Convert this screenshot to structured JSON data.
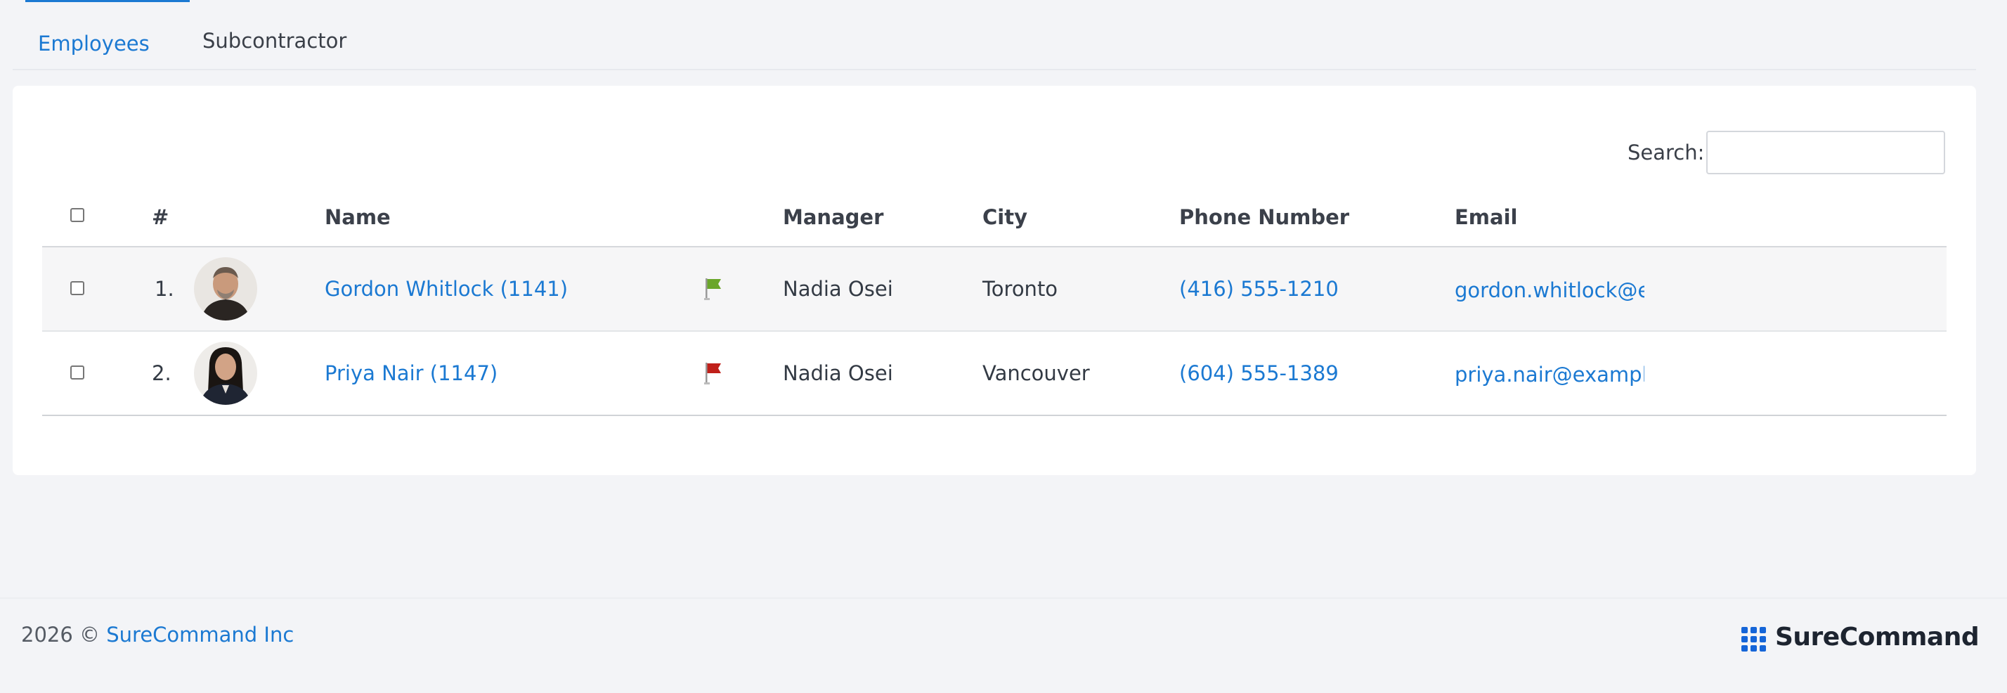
{
  "tabs": [
    {
      "label": "Employees",
      "active": true
    },
    {
      "label": "Subcontractor",
      "active": false
    }
  ],
  "search": {
    "label": "Search:",
    "value": ""
  },
  "table": {
    "headers": {
      "number": "#",
      "name": "Name",
      "manager": "Manager",
      "city": "City",
      "phone": "Phone Number",
      "email": "Email"
    },
    "rows": [
      {
        "index": "1.",
        "name": "Gordon Whitlock (1141)",
        "flag_color": "#6aa62a",
        "manager": "Nadia Osei",
        "city": "Toronto",
        "phone": "(416) 555-1210",
        "email": "gordon.whitlock@e"
      },
      {
        "index": "2.",
        "name": "Priya Nair (1147)",
        "flag_color": "#c0201a",
        "manager": "Nadia Osei",
        "city": "Vancouver",
        "phone": "(604) 555-1389",
        "email": "priya.nair@exampl"
      }
    ]
  },
  "footer": {
    "year": "2026 ©",
    "company": "SureCommand Inc",
    "brand": "SureCommand"
  },
  "colors": {
    "accent": "#1b79d2",
    "brand_icon": "#1565d8"
  }
}
